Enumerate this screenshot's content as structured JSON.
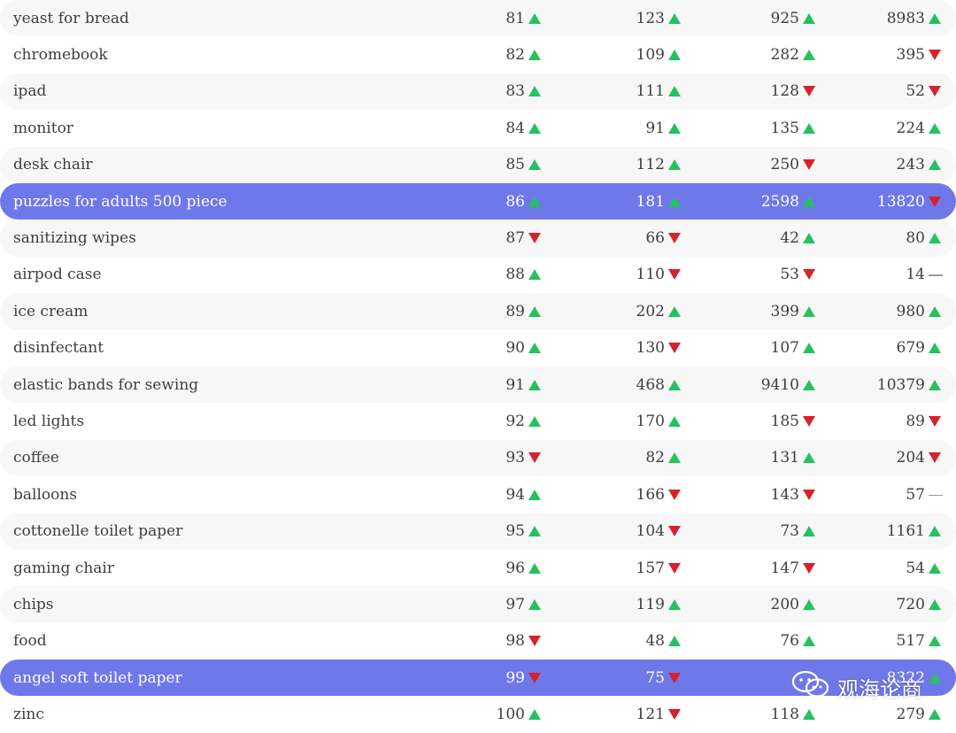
{
  "colors": {
    "up": "#25c160",
    "down": "#d6222b",
    "flat": "#9a9a9a",
    "highlight": "#6f78e9",
    "stripe": "#f7f7f7"
  },
  "rows": [
    {
      "keyword": "yeast for bread",
      "cells": [
        {
          "v": "81",
          "t": "up"
        },
        {
          "v": "123",
          "t": "up"
        },
        {
          "v": "925",
          "t": "up"
        },
        {
          "v": "8983",
          "t": "up"
        }
      ],
      "style": "alt"
    },
    {
      "keyword": "chromebook",
      "cells": [
        {
          "v": "82",
          "t": "up"
        },
        {
          "v": "109",
          "t": "up"
        },
        {
          "v": "282",
          "t": "up"
        },
        {
          "v": "395",
          "t": "down"
        }
      ],
      "style": ""
    },
    {
      "keyword": "ipad",
      "cells": [
        {
          "v": "83",
          "t": "up"
        },
        {
          "v": "111",
          "t": "up"
        },
        {
          "v": "128",
          "t": "down"
        },
        {
          "v": "52",
          "t": "down"
        }
      ],
      "style": "alt"
    },
    {
      "keyword": "monitor",
      "cells": [
        {
          "v": "84",
          "t": "up"
        },
        {
          "v": "91",
          "t": "up"
        },
        {
          "v": "135",
          "t": "up"
        },
        {
          "v": "224",
          "t": "up"
        }
      ],
      "style": ""
    },
    {
      "keyword": "desk chair",
      "cells": [
        {
          "v": "85",
          "t": "up"
        },
        {
          "v": "112",
          "t": "up"
        },
        {
          "v": "250",
          "t": "down"
        },
        {
          "v": "243",
          "t": "up"
        }
      ],
      "style": "alt"
    },
    {
      "keyword": "puzzles for adults 500 piece",
      "cells": [
        {
          "v": "86",
          "t": "up"
        },
        {
          "v": "181",
          "t": "up"
        },
        {
          "v": "2598",
          "t": "up"
        },
        {
          "v": "13820",
          "t": "down"
        }
      ],
      "style": "hl"
    },
    {
      "keyword": "sanitizing wipes",
      "cells": [
        {
          "v": "87",
          "t": "down"
        },
        {
          "v": "66",
          "t": "down"
        },
        {
          "v": "42",
          "t": "up"
        },
        {
          "v": "80",
          "t": "up"
        }
      ],
      "style": "alt"
    },
    {
      "keyword": "airpod case",
      "cells": [
        {
          "v": "88",
          "t": "up"
        },
        {
          "v": "110",
          "t": "down"
        },
        {
          "v": "53",
          "t": "down"
        },
        {
          "v": "14",
          "t": "flat"
        }
      ],
      "style": ""
    },
    {
      "keyword": "ice cream",
      "cells": [
        {
          "v": "89",
          "t": "up"
        },
        {
          "v": "202",
          "t": "up"
        },
        {
          "v": "399",
          "t": "up"
        },
        {
          "v": "980",
          "t": "up"
        }
      ],
      "style": "alt"
    },
    {
      "keyword": "disinfectant",
      "cells": [
        {
          "v": "90",
          "t": "up"
        },
        {
          "v": "130",
          "t": "down"
        },
        {
          "v": "107",
          "t": "up"
        },
        {
          "v": "679",
          "t": "up"
        }
      ],
      "style": ""
    },
    {
      "keyword": "elastic bands for sewing",
      "cells": [
        {
          "v": "91",
          "t": "up"
        },
        {
          "v": "468",
          "t": "up"
        },
        {
          "v": "9410",
          "t": "up"
        },
        {
          "v": "10379",
          "t": "up"
        }
      ],
      "style": "alt"
    },
    {
      "keyword": "led lights",
      "cells": [
        {
          "v": "92",
          "t": "up"
        },
        {
          "v": "170",
          "t": "up"
        },
        {
          "v": "185",
          "t": "down"
        },
        {
          "v": "89",
          "t": "down"
        }
      ],
      "style": ""
    },
    {
      "keyword": "coffee",
      "cells": [
        {
          "v": "93",
          "t": "down"
        },
        {
          "v": "82",
          "t": "up"
        },
        {
          "v": "131",
          "t": "up"
        },
        {
          "v": "204",
          "t": "down"
        }
      ],
      "style": "alt"
    },
    {
      "keyword": "balloons",
      "cells": [
        {
          "v": "94",
          "t": "up"
        },
        {
          "v": "166",
          "t": "down"
        },
        {
          "v": "143",
          "t": "down"
        },
        {
          "v": "57",
          "t": "flat"
        }
      ],
      "style": ""
    },
    {
      "keyword": "cottonelle toilet paper",
      "cells": [
        {
          "v": "95",
          "t": "up"
        },
        {
          "v": "104",
          "t": "down"
        },
        {
          "v": "73",
          "t": "up"
        },
        {
          "v": "1161",
          "t": "up"
        }
      ],
      "style": "alt"
    },
    {
      "keyword": "gaming chair",
      "cells": [
        {
          "v": "96",
          "t": "up"
        },
        {
          "v": "157",
          "t": "down"
        },
        {
          "v": "147",
          "t": "down"
        },
        {
          "v": "54",
          "t": "up"
        }
      ],
      "style": ""
    },
    {
      "keyword": "chips",
      "cells": [
        {
          "v": "97",
          "t": "up"
        },
        {
          "v": "119",
          "t": "up"
        },
        {
          "v": "200",
          "t": "up"
        },
        {
          "v": "720",
          "t": "up"
        }
      ],
      "style": "alt"
    },
    {
      "keyword": "food",
      "cells": [
        {
          "v": "98",
          "t": "down"
        },
        {
          "v": "48",
          "t": "up"
        },
        {
          "v": "76",
          "t": "up"
        },
        {
          "v": "517",
          "t": "up"
        }
      ],
      "style": ""
    },
    {
      "keyword": "angel soft toilet paper",
      "cells": [
        {
          "v": "99",
          "t": "down"
        },
        {
          "v": "75",
          "t": "down"
        },
        {
          "v": "",
          "t": ""
        },
        {
          "v": "8322",
          "t": "up"
        }
      ],
      "style": "hl"
    },
    {
      "keyword": "zinc",
      "cells": [
        {
          "v": "100",
          "t": "up"
        },
        {
          "v": "121",
          "t": "down"
        },
        {
          "v": "118",
          "t": "up"
        },
        {
          "v": "279",
          "t": "up"
        }
      ],
      "style": ""
    }
  ],
  "watermark": {
    "text": "观海论商",
    "icon": "wechat-icon"
  }
}
